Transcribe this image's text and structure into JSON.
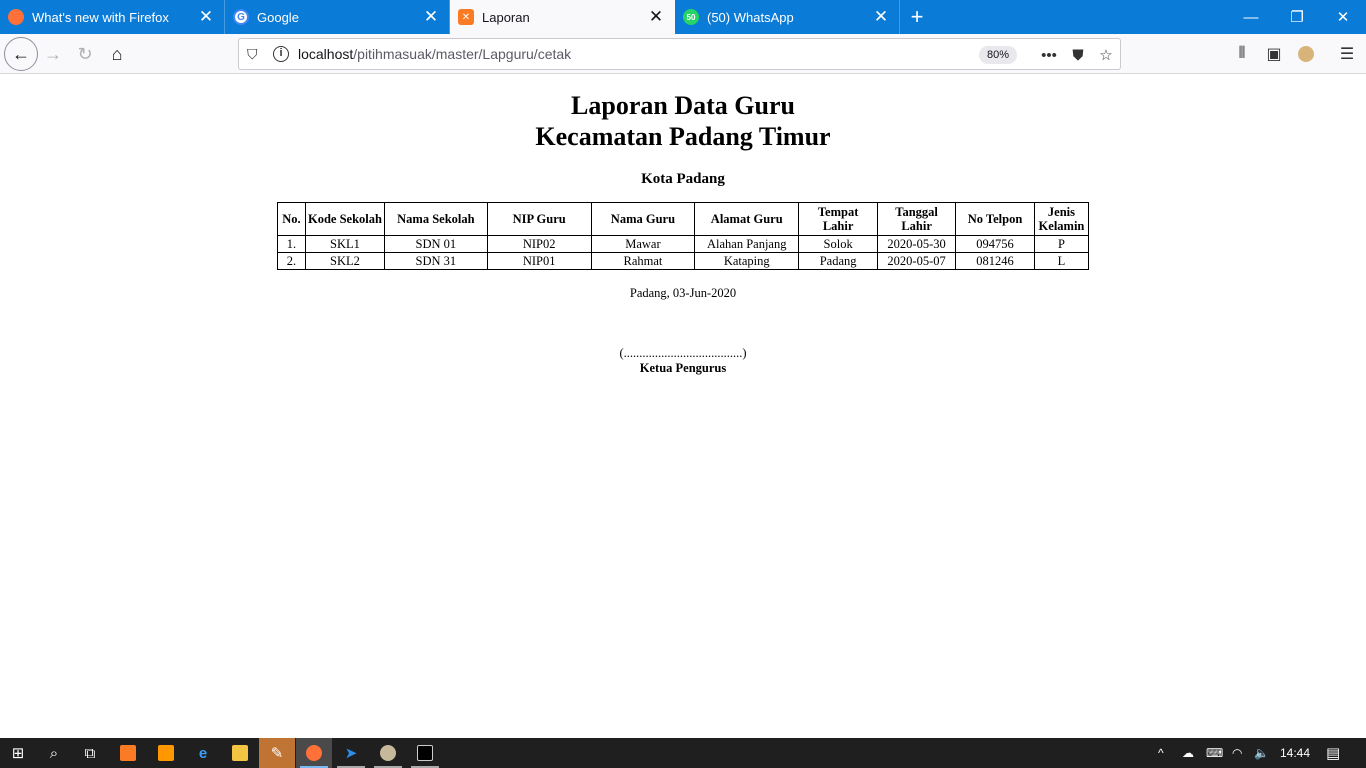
{
  "browser": {
    "tabs": [
      {
        "title": "What's new with Firefox",
        "icon": "firefox-icon",
        "color": "#ff7139"
      },
      {
        "title": "Google",
        "icon": "google-icon",
        "color": "#4285f4"
      },
      {
        "title": "Laporan",
        "icon": "xampp-icon",
        "color": "#fb7a24"
      },
      {
        "title": "(50) WhatsApp",
        "icon": "whatsapp-icon",
        "color": "#25d366"
      }
    ],
    "active_tab": 2,
    "url_host": "localhost",
    "url_path": "/pitihmasuak/master/Lapguru/cetak",
    "zoom": "80%"
  },
  "report": {
    "title_line1": "Laporan Data Guru",
    "title_line2": "Kecamatan Padang Timur",
    "subtitle": "Kota Padang",
    "headers": [
      "No.",
      "Kode Sekolah",
      "Nama Sekolah",
      "NIP Guru",
      "Nama Guru",
      "Alamat Guru",
      "Tempat Lahir",
      "Tanggal Lahir",
      "No Telpon",
      "Jenis Kelamin"
    ],
    "rows": [
      [
        "1.",
        "SKL1",
        "SDN 01",
        "NIP02",
        "Mawar",
        "Alahan Panjang",
        "Solok",
        "2020-05-30",
        "094756",
        "P"
      ],
      [
        "2.",
        "SKL2",
        "SDN 31",
        "NIP01",
        "Rahmat",
        "Kataping",
        "Padang",
        "2020-05-07",
        "081246",
        "L"
      ]
    ],
    "place_date": "Padang, 03-Jun-2020",
    "signature_line": "(......................................)",
    "signer": "Ketua Pengurus"
  },
  "taskbar": {
    "time": "14:44",
    "apps": [
      "start-icon",
      "search-icon",
      "task-view-icon",
      "xampp-icon",
      "sublime-icon",
      "edge-icon",
      "file-explorer-icon",
      "tool-icon",
      "firefox-icon",
      "vscode-icon",
      "paint-icon",
      "cmd-icon"
    ]
  }
}
